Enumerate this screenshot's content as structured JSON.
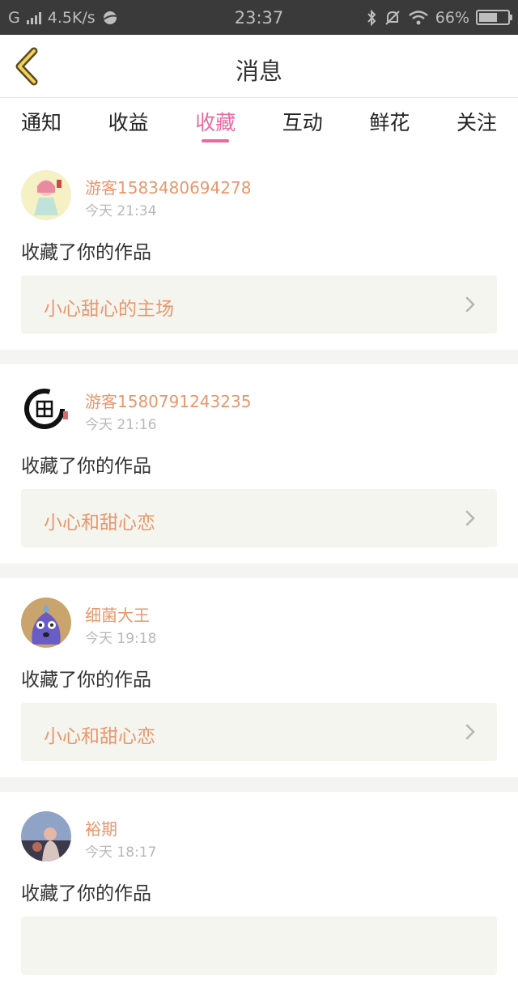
{
  "status_bar": {
    "network_type": "G",
    "speed": "4.5K/s",
    "time": "23:37",
    "battery": "66%",
    "battery_level": 0.66
  },
  "header": {
    "title": "消息"
  },
  "tabs": [
    {
      "label": "通知",
      "active": false
    },
    {
      "label": "收益",
      "active": false
    },
    {
      "label": "收藏",
      "active": true
    },
    {
      "label": "互动",
      "active": false
    },
    {
      "label": "鲜花",
      "active": false
    },
    {
      "label": "关注",
      "active": false
    }
  ],
  "colors": {
    "accent": "#e96a9e",
    "username": "#e8976d",
    "status_bar_bg": "#3a3a3a"
  },
  "feed": [
    {
      "username": "游客1583480694278",
      "time": "今天 21:34",
      "action": "收藏了你的作品",
      "work": "小心甜心的主场",
      "avatar": "anime-girl-avatar"
    },
    {
      "username": "游客1580791243235",
      "time": "今天 21:16",
      "action": "收藏了你的作品",
      "work": "小心和甜心恋",
      "avatar": "calligraphy-avatar"
    },
    {
      "username": "细菌大王",
      "time": "今天 19:18",
      "action": "收藏了你的作品",
      "work": "小心和甜心恋",
      "avatar": "purple-monster-avatar"
    },
    {
      "username": "裕期",
      "time": "今天 18:17",
      "action": "收藏了你的作品",
      "work": "",
      "avatar": "photo-avatar"
    }
  ]
}
